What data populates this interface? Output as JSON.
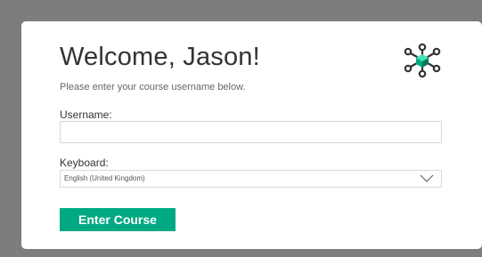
{
  "login": {
    "title": "Welcome, Jason!",
    "subtitle": "Please enter your course username below.",
    "username_label": "Username:",
    "username_value": "",
    "keyboard_label": "Keyboard:",
    "keyboard_selected": "English (United Kingdom)",
    "submit_label": "Enter Course"
  },
  "icons": {
    "logo": "network-hub-icon",
    "dropdown": "chevron-down-icon"
  },
  "colors": {
    "accent": "#01a982",
    "background": "#7d7d7d",
    "card": "#ffffff"
  }
}
